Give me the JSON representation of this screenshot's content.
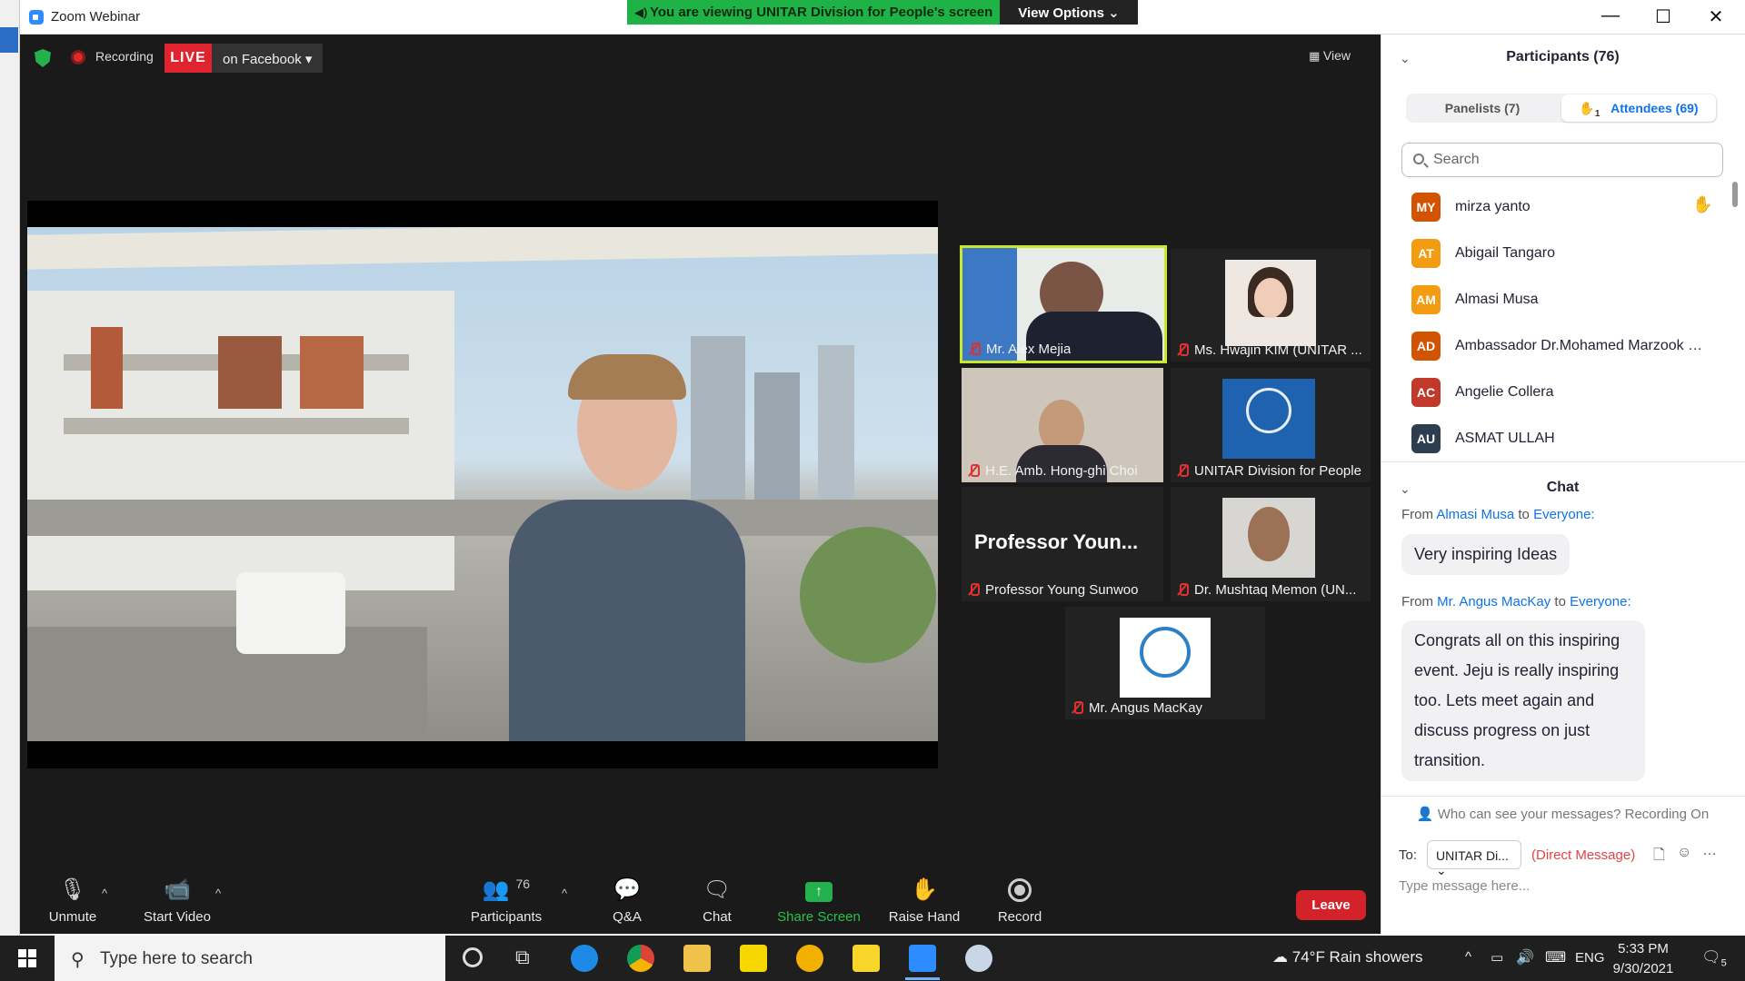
{
  "window": {
    "title": "Zoom Webinar",
    "banner": "You are viewing UNITAR Division for People's screen",
    "view_options": "View Options ⌄",
    "min": "—",
    "max": "☐",
    "close": "✕"
  },
  "meeting": {
    "recording": "Recording",
    "live": "LIVE",
    "on_facebook": "on Facebook ▾",
    "view": "View"
  },
  "tiles": [
    {
      "name": "Mr. Alex Mejia"
    },
    {
      "name": "Ms. Hwajin KIM (UNITAR ..."
    },
    {
      "name": "H.E. Amb. Hong-ghi Choi"
    },
    {
      "name": "UNITAR Division for People"
    },
    {
      "name": "Professor Young Sunwoo",
      "big": "Professor Youn..."
    },
    {
      "name": "Dr. Mushtaq Memon (UN..."
    },
    {
      "name": "Mr. Angus MacKay"
    }
  ],
  "toolbar": {
    "unmute": "Unmute",
    "start_video": "Start Video",
    "participants": "Participants",
    "participant_count": "76",
    "qa": "Q&A",
    "chat": "Chat",
    "share": "Share Screen",
    "raise": "Raise Hand",
    "record": "Record",
    "leave": "Leave"
  },
  "panel": {
    "title": "Participants (76)",
    "tab_panelists": "Panelists (7)",
    "tab_attendees": "Attendees (69)",
    "hand_count": "1",
    "search_placeholder": "Search",
    "participants": [
      {
        "initials": "MY",
        "name": "mirza yanto",
        "color": "#d35400"
      },
      {
        "initials": "AT",
        "name": "Abigail Tangaro",
        "color": "#f39c12"
      },
      {
        "initials": "AM",
        "name": "Almasi Musa",
        "color": "#f39c12"
      },
      {
        "initials": "AD",
        "name": "Ambassador Dr.Mohamed Marzook M...",
        "color": "#d35400"
      },
      {
        "initials": "AC",
        "name": "Angelie Collera",
        "color": "#c0392b"
      },
      {
        "initials": "AU",
        "name": "ASMAT ULLAH",
        "color": "#2c3e50"
      }
    ]
  },
  "chat": {
    "title": "Chat",
    "msg1": {
      "from": "From",
      "sender": "Almasi Musa",
      "to": "to",
      "target": "Everyone:",
      "text": "Very inspiring Ideas"
    },
    "msg2": {
      "from": "From",
      "sender": "Mr. Angus MacKay",
      "to": "to",
      "target": "Everyone:",
      "lines": [
        "Congrats all on this inspiring",
        "event. Jeju is really inspiring",
        "too. Lets meet again and",
        "discuss progress on just",
        "transition."
      ]
    },
    "who_can_see": "Who can see your messages? Recording On",
    "to_label": "To:",
    "to_value": "UNITAR Di... ⌄",
    "direct": "(Direct Message)",
    "placeholder": "Type message here..."
  },
  "taskbar": {
    "search": "Type here to search",
    "weather": "74°F  Rain showers",
    "lang": "ENG",
    "time": "5:33 PM",
    "date": "9/30/2021",
    "notifications": "5"
  }
}
